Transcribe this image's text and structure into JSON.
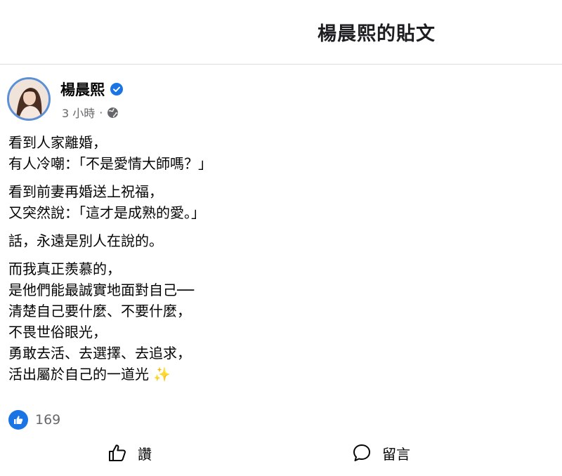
{
  "header": {
    "title": "楊晨熙的貼文"
  },
  "post": {
    "author": "楊晨熙",
    "verified_icon": "verified-badge-icon",
    "time": "3 小時",
    "separator": "·",
    "privacy_icon": "globe-icon",
    "paragraphs": [
      [
        "看到人家離婚，",
        "有人冷嘲：「不是愛情大師嗎？」"
      ],
      [
        "看到前妻再婚送上祝福，",
        "又突然說：「這才是成熟的愛。」"
      ],
      [
        "話，永遠是別人在說的。"
      ],
      [
        "而我真正羨慕的，",
        "是他們能最誠實地面對自己──",
        "清楚自己要什麼、不要什麼，",
        "不畏世俗眼光，",
        "勇敢去活、去選擇、去追求，",
        "活出屬於自己的一道光"
      ]
    ],
    "closing_emoji": "✨",
    "like_count": "169"
  },
  "actions": {
    "like_label": "讚",
    "comment_label": "留言"
  },
  "colors": {
    "accent": "#1b74e4",
    "secondary_text": "#65676b",
    "divider": "#dadde1"
  }
}
